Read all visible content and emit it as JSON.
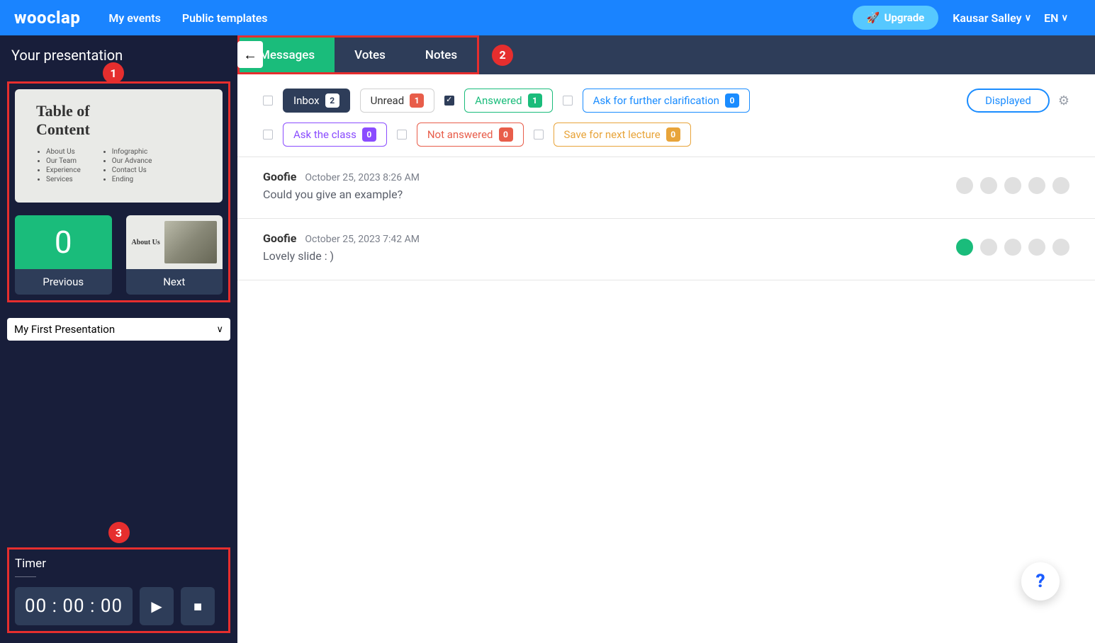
{
  "header": {
    "logo": "wooclap",
    "my_events": "My events",
    "public_templates": "Public templates",
    "upgrade": "Upgrade",
    "user_name": "Kausar Salley",
    "lang": "EN"
  },
  "sidebar": {
    "title": "Your presentation",
    "slide_title_1": "Table of",
    "slide_title_2": "Content",
    "toc_left": [
      "About Us",
      "Our Team",
      "Experience",
      "Services"
    ],
    "toc_right": [
      "Infographic",
      "Our Advance",
      "Contact Us",
      "Ending"
    ],
    "prev_value": "0",
    "prev_label": "Previous",
    "next_title": "About Us",
    "next_label": "Next",
    "preso_select": "My First Presentation",
    "timer_title": "Timer",
    "timer_value": "00 : 00 : 00"
  },
  "tabs": {
    "messages": "Messages",
    "votes": "Votes",
    "notes": "Notes"
  },
  "filters": {
    "inbox": {
      "label": "Inbox",
      "count": "2"
    },
    "unread": {
      "label": "Unread",
      "count": "1"
    },
    "answered": {
      "label": "Answered",
      "count": "1"
    },
    "ask_clarification": {
      "label": "Ask for further clarification",
      "count": "0"
    },
    "ask_class": {
      "label": "Ask the class",
      "count": "0"
    },
    "not_answered": {
      "label": "Not answered",
      "count": "0"
    },
    "save_next": {
      "label": "Save for next lecture",
      "count": "0"
    },
    "displayed": "Displayed"
  },
  "messages": [
    {
      "author": "Goofie",
      "date": "October 25, 2023 8:26 AM",
      "body": "Could you give an example?",
      "tags": [
        false,
        false,
        false,
        false,
        false
      ]
    },
    {
      "author": "Goofie",
      "date": "October 25, 2023 7:42 AM",
      "body": "Lovely slide : )",
      "tags": [
        true,
        false,
        false,
        false,
        false
      ]
    }
  ],
  "annotations": {
    "a1": "1",
    "a2": "2",
    "a3": "3"
  }
}
